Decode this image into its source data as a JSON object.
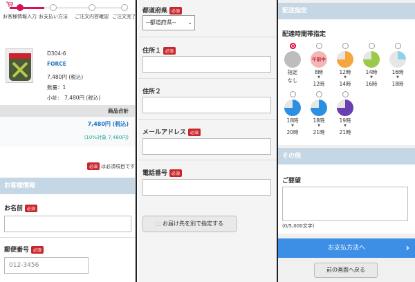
{
  "steps": [
    {
      "label": "お客様情報入力"
    },
    {
      "label": "お支払い方法"
    },
    {
      "label": "ご注文内容確認"
    },
    {
      "label": "ご注文完了"
    }
  ],
  "product": {
    "code": "D304-6",
    "name": "FORCE",
    "price": "7,480円 (税込)",
    "qty": "数量：1",
    "subtotal": "小計:　7,480円 (税込)"
  },
  "totals": {
    "header": "商品合計",
    "amount": "7,480円 (税込)",
    "tax": "(10%対象 7,480円)"
  },
  "required_badge": "必須",
  "required_note": "は必須項目です",
  "customer_section": "お客様情報",
  "name_label": "お名前",
  "zip_label": "郵便番号",
  "zip_placeholder": "012-3456",
  "pref_label": "都道府県",
  "pref_select": "--都道府県--",
  "addr1_label": "住所１",
  "addr2_label": "住所２",
  "email_label": "メールアドレス",
  "phone_label": "電話番号",
  "alt_address_button": "お届け先を別で指定する",
  "delivery_section": "配送指定",
  "delivery_time_label": "配達時間帯指定",
  "time_slots": [
    {
      "top": "指定",
      "bottom": "なし",
      "color": "#bdbdbd",
      "fill": 1,
      "selected": true
    },
    {
      "top": "8時",
      "bottom": "12時",
      "color": "#f2b8b8",
      "fill": 1,
      "noon": "午前中"
    },
    {
      "top": "12時",
      "bottom": "14時",
      "color": "#f5a63c",
      "fill": 0.75
    },
    {
      "top": "14時",
      "bottom": "16時",
      "color": "#9bc94a",
      "fill": 0.75
    },
    {
      "top": "16時",
      "bottom": "18時",
      "color": "#8fd1e8",
      "fill": 0.25
    },
    {
      "top": "18時",
      "bottom": "20時",
      "color": "#2c8fe0",
      "fill": 0.75
    },
    {
      "top": "18時",
      "bottom": "21時",
      "color": "#2c8fe0",
      "fill": 0.75
    },
    {
      "top": "19時",
      "bottom": "21時",
      "color": "#6a3fb0",
      "fill": 0.75
    }
  ],
  "other_section": "その他",
  "request_label": "ご要望",
  "char_count": "(0/5,000文字)",
  "pay_button": "お支払方法へ",
  "back_button": "前の画面へ戻る"
}
